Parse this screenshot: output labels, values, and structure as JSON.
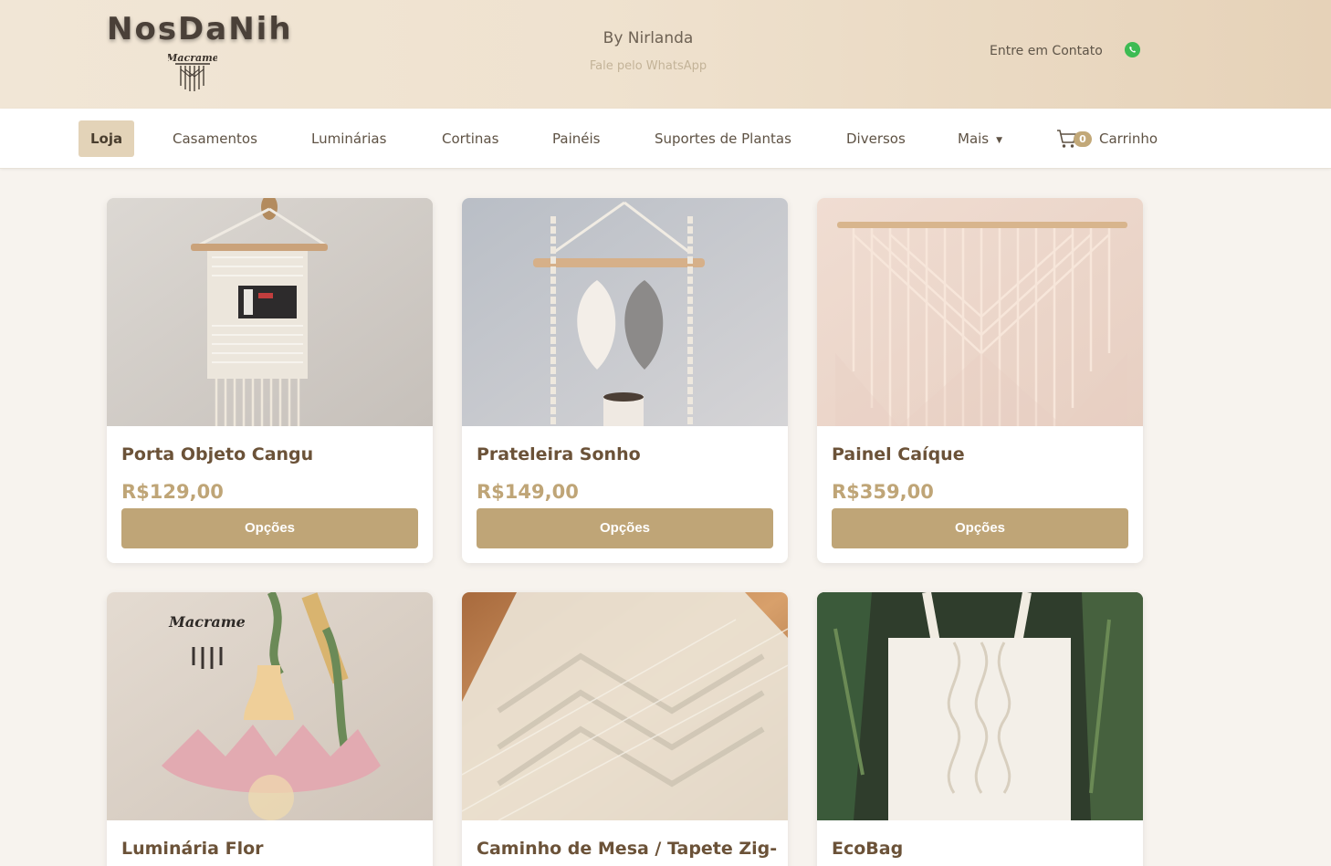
{
  "header": {
    "logo": "NosDaNih",
    "logo_badge": "Macrame",
    "by_line": "By Nirlanda",
    "fale_line": "Fale pelo WhatsApp",
    "contato": "Entre em Contato",
    "whatsapp_icon": "whatsapp-icon"
  },
  "nav": {
    "items": [
      {
        "label": "Loja"
      },
      {
        "label": "Casamentos"
      },
      {
        "label": "Luminárias"
      },
      {
        "label": "Cortinas"
      },
      {
        "label": "Painéis"
      },
      {
        "label": "Suportes de Plantas"
      },
      {
        "label": "Diversos"
      },
      {
        "label": "Mais"
      }
    ],
    "cart_count": "0",
    "cart_label": "Carrinho"
  },
  "products": [
    {
      "title": "Porta Objeto Cangu",
      "price": "R$129,00",
      "button": "Opções"
    },
    {
      "title": "Prateleira Sonho",
      "price": "R$149,00",
      "button": "Opções"
    },
    {
      "title": "Painel Caíque",
      "price": "R$359,00",
      "button": "Opções"
    },
    {
      "title": "Luminária Flor",
      "price": "",
      "button": ""
    },
    {
      "title": "Caminho de Mesa / Tapete Zig-",
      "price": "",
      "button": ""
    },
    {
      "title": "EcoBag",
      "price": "",
      "button": ""
    }
  ],
  "colors": {
    "accent": "#bfa577",
    "header_bg": "#efe2cf",
    "nav_active": "#e3d3b8",
    "title": "#6b5238"
  }
}
